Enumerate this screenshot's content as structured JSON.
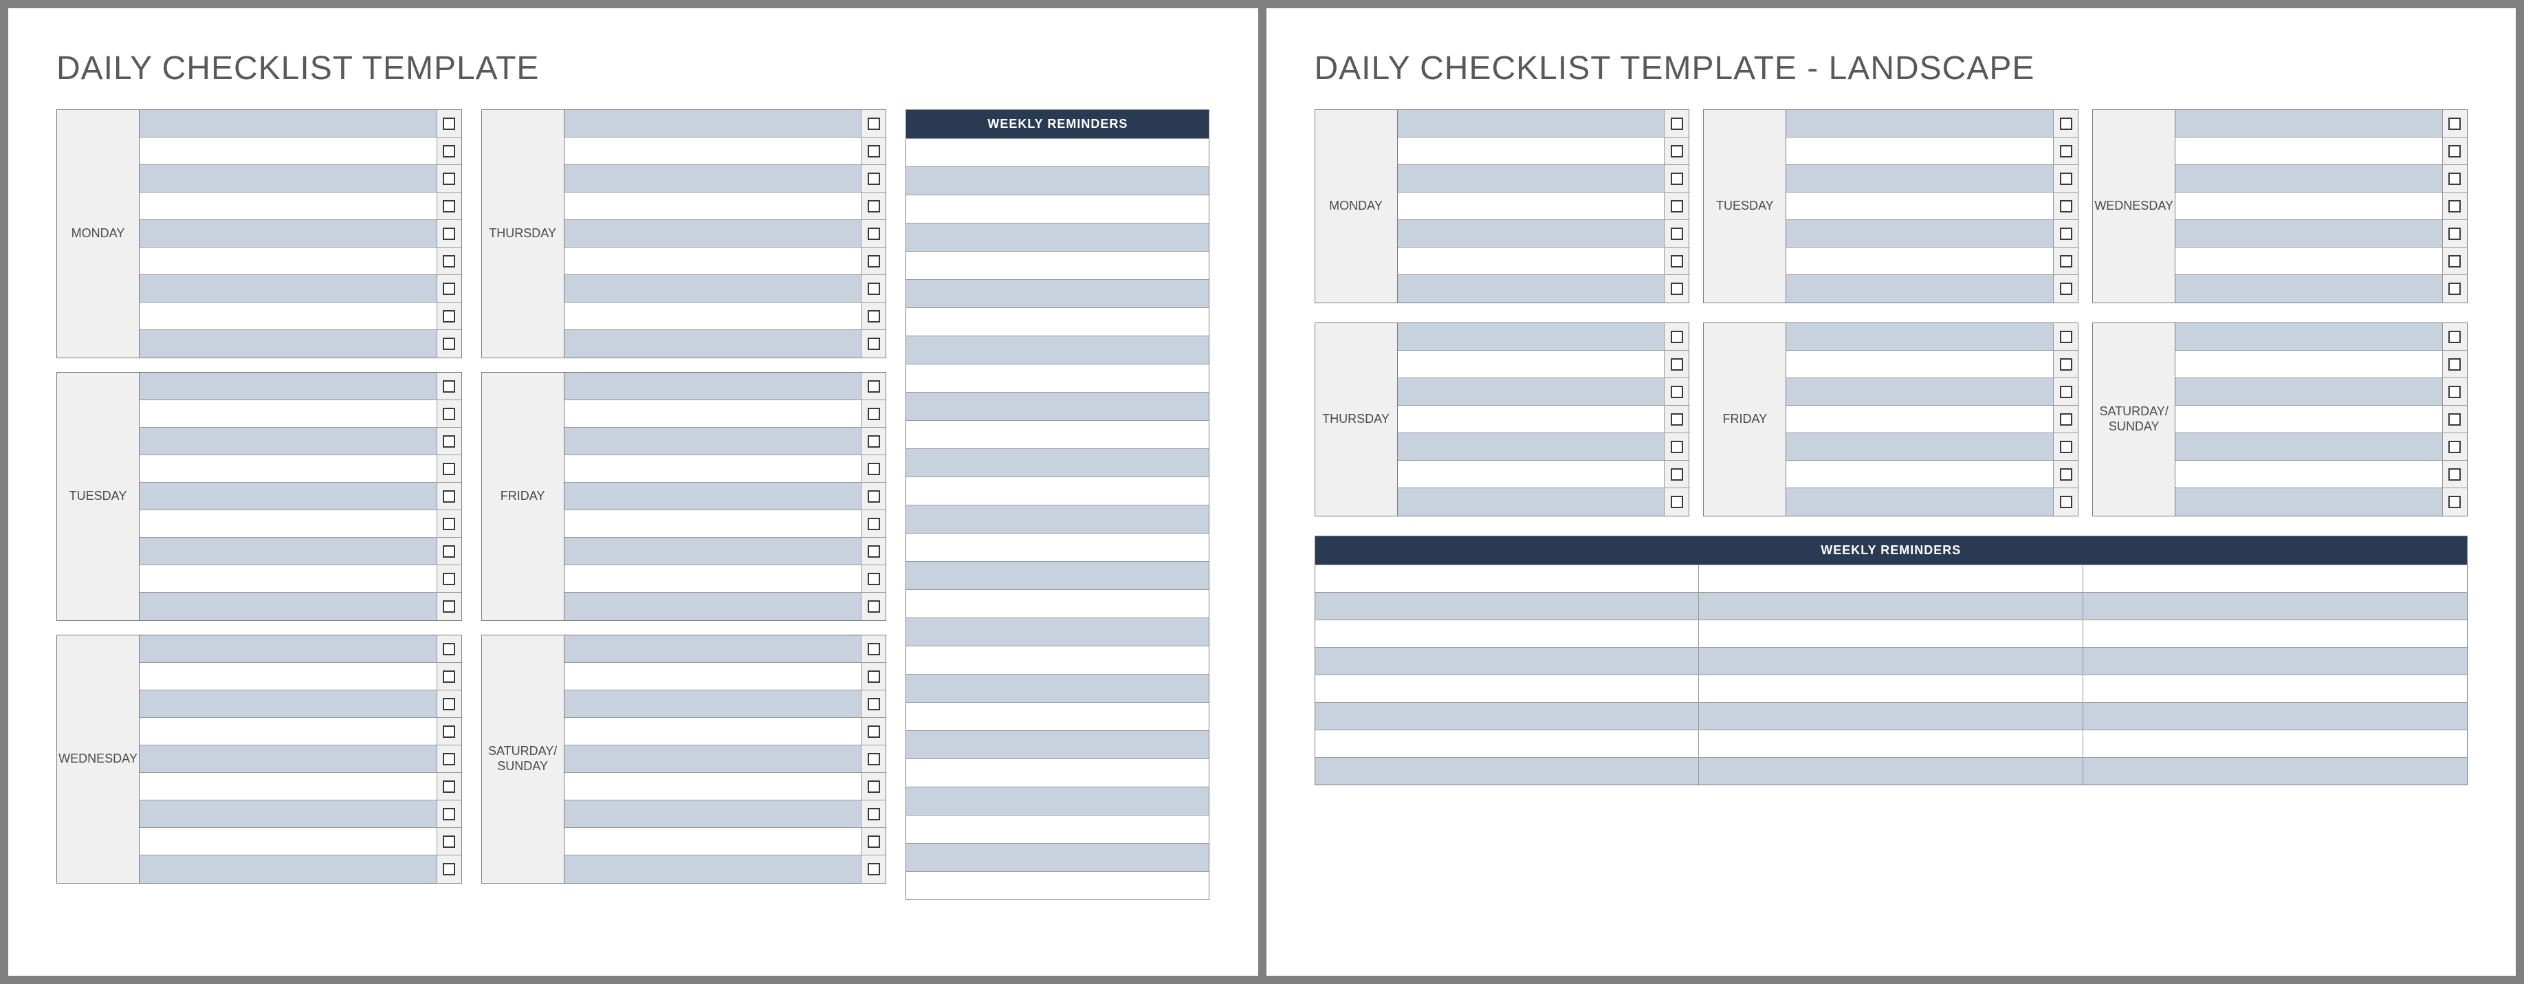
{
  "portrait": {
    "title": "DAILY CHECKLIST TEMPLATE",
    "col1": [
      "MONDAY",
      "TUESDAY",
      "WEDNESDAY"
    ],
    "col2": [
      "THURSDAY",
      "FRIDAY",
      "SATURDAY/ SUNDAY"
    ],
    "rows_per_day": 9,
    "reminders_header": "WEEKLY REMINDERS",
    "reminders_rows": 27
  },
  "landscape": {
    "title": "DAILY CHECKLIST TEMPLATE - LANDSCAPE",
    "row1": [
      "MONDAY",
      "TUESDAY",
      "WEDNESDAY"
    ],
    "row2": [
      "THURSDAY",
      "FRIDAY",
      "SATURDAY/ SUNDAY"
    ],
    "rows_per_day": 7,
    "reminders_header": "WEEKLY REMINDERS",
    "reminders_rows": 8,
    "reminders_cols": 3
  }
}
